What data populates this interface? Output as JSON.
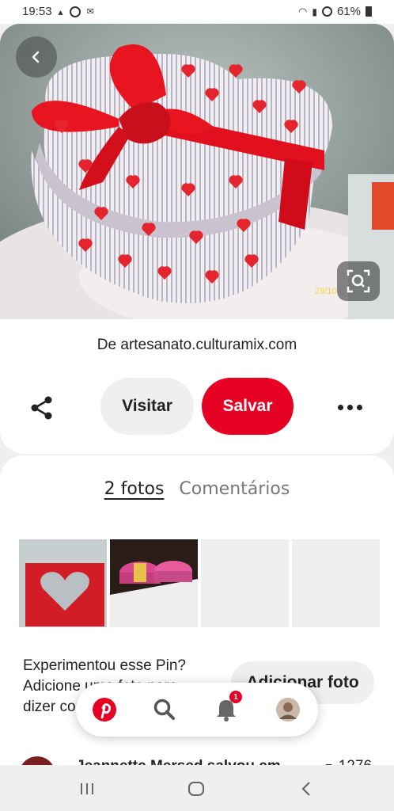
{
  "status_bar": {
    "time": "19:53",
    "battery": "61%"
  },
  "hero": {
    "image_stamp": "29/10"
  },
  "pin": {
    "source_prefix": "De",
    "source_domain": "artesanato.culturamix.com",
    "visit_label": "Visitar",
    "save_label": "Salvar"
  },
  "tabs": {
    "photos": "2 fotos",
    "comments": "Comentários"
  },
  "tried": {
    "line1": "Experimentou esse Pin?",
    "line2": "Adicione uma foto para",
    "line3": "dizer como ficou",
    "add_photo_label": "Adicionar foto"
  },
  "activity": {
    "text": "Jeannette Mersed salvou em",
    "count": "1276"
  },
  "nav": {
    "notification_count": "1"
  },
  "colors": {
    "brand_red": "#e60023"
  }
}
